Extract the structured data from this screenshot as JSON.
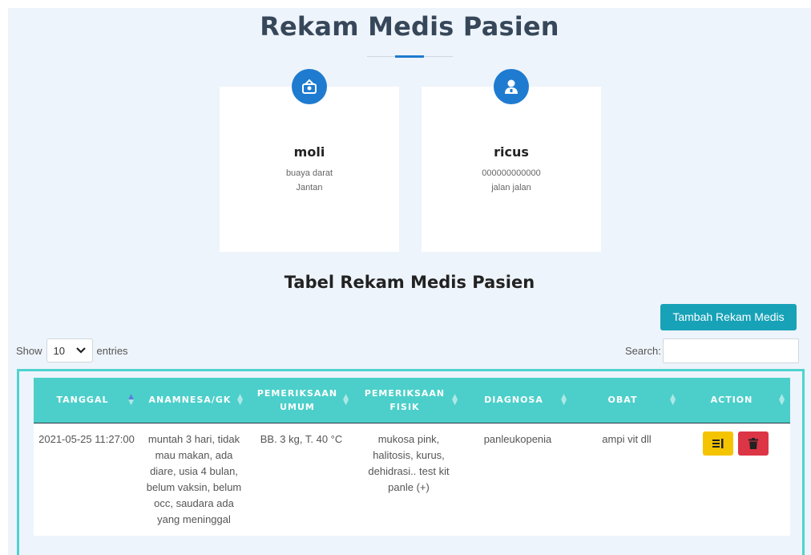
{
  "page": {
    "title": "Rekam Medis Pasien",
    "table_title": "Tabel Rekam Medis Pasien"
  },
  "cards": [
    {
      "icon": "pet-carrier-icon",
      "name": "moli",
      "line1": "buaya darat",
      "line2": "Jantan"
    },
    {
      "icon": "user-doctor-icon",
      "name": "ricus",
      "line1": "000000000000",
      "line2": "jalan jalan"
    }
  ],
  "toolbar": {
    "add_label": "Tambah Rekam Medis",
    "show_label": "Show",
    "entries_value": "10",
    "entries_label": "entries",
    "search_label": "Search:",
    "search_value": ""
  },
  "table": {
    "columns": [
      "TANGGAL",
      "ANAMNESA/GK",
      "PEMERIKSAAN UMUM",
      "PEMERIKSAAN FISIK",
      "DIAGNOSA",
      "OBAT",
      "ACTION"
    ],
    "rows": [
      {
        "tanggal": "2021-05-25 11:27:00",
        "anamnesa": "muntah 3 hari, tidak mau makan, ada diare, usia 4 bulan, belum vaksin, belum occ, saudara ada yang meninggal",
        "umum": "BB. 3 kg, T. 40 °C",
        "fisik": "mukosa pink, halitosis, kurus, dehidrasi.. test kit panle (+)",
        "diagnosa": "panleukopenia",
        "obat": "ampi vit dll"
      }
    ]
  },
  "colors": {
    "accent": "#1e7bd0",
    "table_header": "#4ccfca",
    "add_button": "#17a2b8",
    "edit_button": "#f5c400",
    "delete_button": "#dc3545"
  }
}
